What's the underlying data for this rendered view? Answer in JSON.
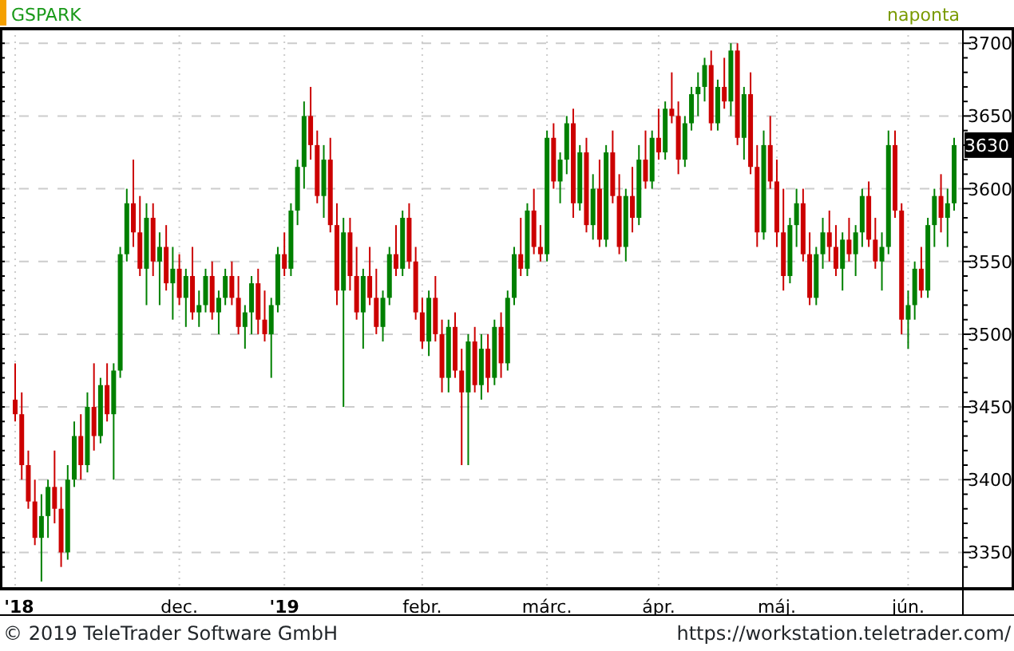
{
  "chart": {
    "symbol": "GSPARK",
    "interval": "naponta",
    "current_price": "3630",
    "x_axis_labels": [
      {
        "bold": true
      },
      {
        "bold": false
      },
      {
        "bold": true
      },
      {
        "bold": false
      },
      {
        "bold": false
      },
      {
        "bold": false
      },
      {
        "bold": false
      },
      {
        "bold": false
      }
    ],
    "chart_data": {
      "type": "candlestick",
      "ylim": [
        3325,
        3710
      ],
      "grid": true,
      "yticks": [
        3700,
        3650,
        3600,
        3550,
        3500,
        3450,
        3400,
        3350
      ],
      "categories": [
        "'18",
        null,
        null,
        null,
        null,
        null,
        null,
        null,
        null,
        null,
        null,
        null,
        null,
        null,
        null,
        null,
        null,
        null,
        null,
        null,
        null,
        null,
        null,
        null,
        null,
        "dec.",
        null,
        null,
        null,
        null,
        null,
        null,
        null,
        null,
        null,
        null,
        null,
        null,
        null,
        null,
        null,
        "'19",
        null,
        null,
        null,
        null,
        null,
        null,
        null,
        null,
        null,
        null,
        null,
        null,
        null,
        null,
        null,
        null,
        null,
        null,
        null,
        null,
        "febr.",
        null,
        null,
        null,
        null,
        null,
        null,
        null,
        null,
        null,
        null,
        null,
        null,
        null,
        null,
        null,
        null,
        null,
        null,
        "márc.",
        null,
        null,
        null,
        null,
        null,
        null,
        null,
        null,
        null,
        null,
        null,
        null,
        null,
        null,
        null,
        null,
        "ápr.",
        null,
        null,
        null,
        null,
        null,
        null,
        null,
        null,
        null,
        null,
        null,
        null,
        null,
        null,
        null,
        null,
        null,
        "máj.",
        null,
        null,
        null,
        null,
        null,
        null,
        null,
        null,
        null,
        null,
        null,
        null,
        null,
        null,
        null,
        null,
        null,
        null,
        null,
        "jún.",
        null,
        null,
        null,
        null,
        null,
        null,
        null
      ],
      "ohlc": [
        [
          3455,
          3480,
          3440,
          3445
        ],
        [
          3445,
          3460,
          3400,
          3410
        ],
        [
          3410,
          3420,
          3380,
          3385
        ],
        [
          3385,
          3400,
          3355,
          3360
        ],
        [
          3360,
          3390,
          3330,
          3375
        ],
        [
          3375,
          3400,
          3360,
          3395
        ],
        [
          3395,
          3420,
          3370,
          3380
        ],
        [
          3380,
          3395,
          3340,
          3350
        ],
        [
          3350,
          3410,
          3345,
          3400
        ],
        [
          3400,
          3440,
          3395,
          3430
        ],
        [
          3430,
          3445,
          3400,
          3410
        ],
        [
          3410,
          3460,
          3405,
          3450
        ],
        [
          3450,
          3480,
          3420,
          3430
        ],
        [
          3430,
          3470,
          3425,
          3465
        ],
        [
          3465,
          3480,
          3440,
          3445
        ],
        [
          3445,
          3480,
          3400,
          3475
        ],
        [
          3475,
          3560,
          3470,
          3555
        ],
        [
          3555,
          3600,
          3550,
          3590
        ],
        [
          3590,
          3620,
          3560,
          3570
        ],
        [
          3570,
          3595,
          3540,
          3545
        ],
        [
          3545,
          3590,
          3520,
          3580
        ],
        [
          3580,
          3590,
          3540,
          3550
        ],
        [
          3550,
          3570,
          3520,
          3560
        ],
        [
          3560,
          3575,
          3530,
          3535
        ],
        [
          3535,
          3560,
          3510,
          3545
        ],
        [
          3545,
          3555,
          3520,
          3525
        ],
        [
          3525,
          3545,
          3505,
          3540
        ],
        [
          3540,
          3560,
          3510,
          3515
        ],
        [
          3515,
          3530,
          3505,
          3520
        ],
        [
          3520,
          3545,
          3515,
          3540
        ],
        [
          3540,
          3550,
          3510,
          3515
        ],
        [
          3515,
          3530,
          3500,
          3525
        ],
        [
          3525,
          3545,
          3520,
          3540
        ],
        [
          3540,
          3550,
          3520,
          3525
        ],
        [
          3525,
          3540,
          3500,
          3505
        ],
        [
          3505,
          3520,
          3490,
          3515
        ],
        [
          3515,
          3540,
          3500,
          3535
        ],
        [
          3535,
          3545,
          3500,
          3510
        ],
        [
          3510,
          3530,
          3495,
          3500
        ],
        [
          3500,
          3525,
          3470,
          3520
        ],
        [
          3520,
          3560,
          3515,
          3555
        ],
        [
          3555,
          3570,
          3540,
          3545
        ],
        [
          3545,
          3590,
          3540,
          3585
        ],
        [
          3585,
          3620,
          3575,
          3615
        ],
        [
          3615,
          3660,
          3600,
          3650
        ],
        [
          3650,
          3670,
          3620,
          3630
        ],
        [
          3630,
          3640,
          3590,
          3595
        ],
        [
          3595,
          3630,
          3580,
          3620
        ],
        [
          3620,
          3635,
          3570,
          3575
        ],
        [
          3575,
          3590,
          3520,
          3530
        ],
        [
          3530,
          3580,
          3450,
          3570
        ],
        [
          3570,
          3580,
          3530,
          3540
        ],
        [
          3540,
          3560,
          3510,
          3515
        ],
        [
          3515,
          3545,
          3490,
          3540
        ],
        [
          3540,
          3560,
          3520,
          3525
        ],
        [
          3525,
          3545,
          3500,
          3505
        ],
        [
          3505,
          3530,
          3495,
          3525
        ],
        [
          3525,
          3560,
          3520,
          3555
        ],
        [
          3555,
          3575,
          3540,
          3545
        ],
        [
          3545,
          3585,
          3540,
          3580
        ],
        [
          3580,
          3590,
          3545,
          3550
        ],
        [
          3550,
          3560,
          3510,
          3515
        ],
        [
          3515,
          3525,
          3490,
          3495
        ],
        [
          3495,
          3530,
          3485,
          3525
        ],
        [
          3525,
          3540,
          3495,
          3500
        ],
        [
          3500,
          3510,
          3460,
          3470
        ],
        [
          3470,
          3510,
          3460,
          3505
        ],
        [
          3505,
          3515,
          3470,
          3475
        ],
        [
          3475,
          3490,
          3410,
          3460
        ],
        [
          3460,
          3500,
          3410,
          3495
        ],
        [
          3495,
          3505,
          3460,
          3465
        ],
        [
          3465,
          3500,
          3455,
          3490
        ],
        [
          3490,
          3500,
          3460,
          3470
        ],
        [
          3470,
          3510,
          3465,
          3505
        ],
        [
          3505,
          3515,
          3470,
          3480
        ],
        [
          3480,
          3530,
          3475,
          3525
        ],
        [
          3525,
          3560,
          3520,
          3555
        ],
        [
          3555,
          3580,
          3540,
          3545
        ],
        [
          3545,
          3590,
          3540,
          3585
        ],
        [
          3585,
          3600,
          3555,
          3560
        ],
        [
          3560,
          3575,
          3550,
          3555
        ],
        [
          3555,
          3640,
          3550,
          3635
        ],
        [
          3635,
          3645,
          3600,
          3605
        ],
        [
          3605,
          3625,
          3590,
          3620
        ],
        [
          3620,
          3650,
          3610,
          3645
        ],
        [
          3645,
          3655,
          3580,
          3590
        ],
        [
          3590,
          3630,
          3585,
          3625
        ],
        [
          3625,
          3635,
          3570,
          3575
        ],
        [
          3575,
          3610,
          3565,
          3600
        ],
        [
          3600,
          3620,
          3560,
          3565
        ],
        [
          3565,
          3630,
          3560,
          3625
        ],
        [
          3625,
          3640,
          3590,
          3595
        ],
        [
          3595,
          3610,
          3555,
          3560
        ],
        [
          3560,
          3600,
          3550,
          3595
        ],
        [
          3595,
          3615,
          3570,
          3580
        ],
        [
          3580,
          3630,
          3575,
          3620
        ],
        [
          3620,
          3640,
          3600,
          3605
        ],
        [
          3605,
          3640,
          3600,
          3635
        ],
        [
          3635,
          3655,
          3620,
          3625
        ],
        [
          3625,
          3660,
          3620,
          3655
        ],
        [
          3655,
          3680,
          3645,
          3650
        ],
        [
          3650,
          3660,
          3610,
          3620
        ],
        [
          3620,
          3650,
          3615,
          3645
        ],
        [
          3645,
          3670,
          3640,
          3665
        ],
        [
          3665,
          3680,
          3650,
          3670
        ],
        [
          3670,
          3690,
          3660,
          3685
        ],
        [
          3685,
          3695,
          3640,
          3645
        ],
        [
          3645,
          3675,
          3640,
          3670
        ],
        [
          3670,
          3690,
          3655,
          3660
        ],
        [
          3660,
          3700,
          3650,
          3695
        ],
        [
          3695,
          3700,
          3630,
          3635
        ],
        [
          3635,
          3670,
          3620,
          3665
        ],
        [
          3665,
          3680,
          3610,
          3615
        ],
        [
          3615,
          3630,
          3560,
          3570
        ],
        [
          3570,
          3640,
          3565,
          3630
        ],
        [
          3630,
          3650,
          3600,
          3605
        ],
        [
          3605,
          3620,
          3560,
          3570
        ],
        [
          3570,
          3600,
          3530,
          3540
        ],
        [
          3540,
          3580,
          3535,
          3575
        ],
        [
          3575,
          3600,
          3560,
          3590
        ],
        [
          3590,
          3600,
          3550,
          3555
        ],
        [
          3555,
          3570,
          3520,
          3525
        ],
        [
          3525,
          3560,
          3520,
          3555
        ],
        [
          3555,
          3580,
          3545,
          3570
        ],
        [
          3570,
          3585,
          3550,
          3560
        ],
        [
          3560,
          3575,
          3540,
          3545
        ],
        [
          3545,
          3570,
          3530,
          3565
        ],
        [
          3565,
          3580,
          3550,
          3555
        ],
        [
          3555,
          3575,
          3540,
          3570
        ],
        [
          3570,
          3600,
          3560,
          3595
        ],
        [
          3595,
          3605,
          3560,
          3565
        ],
        [
          3565,
          3580,
          3545,
          3550
        ],
        [
          3550,
          3570,
          3530,
          3560
        ],
        [
          3560,
          3640,
          3555,
          3630
        ],
        [
          3630,
          3640,
          3580,
          3585
        ],
        [
          3585,
          3590,
          3500,
          3510
        ],
        [
          3510,
          3530,
          3490,
          3520
        ],
        [
          3520,
          3550,
          3510,
          3545
        ],
        [
          3545,
          3560,
          3525,
          3530
        ],
        [
          3530,
          3580,
          3525,
          3575
        ],
        [
          3575,
          3600,
          3560,
          3595
        ],
        [
          3595,
          3610,
          3570,
          3580
        ],
        [
          3580,
          3600,
          3560,
          3590
        ],
        [
          3590,
          3635,
          3585,
          3630
        ]
      ]
    }
  },
  "footer": {
    "copyright": "© 2019 TeleTrader Software GmbH",
    "url": "https://workstation.teletrader.com/"
  }
}
